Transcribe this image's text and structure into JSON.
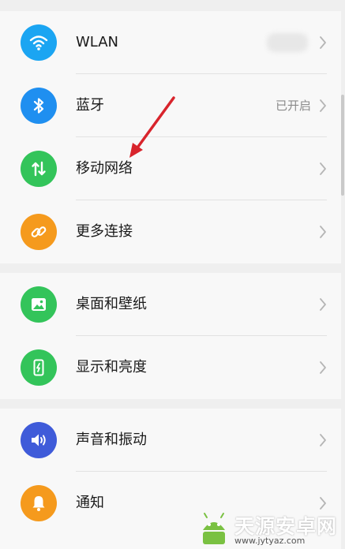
{
  "settings": {
    "wlan": {
      "label": "WLAN",
      "value": ""
    },
    "bluetooth": {
      "label": "蓝牙",
      "value": "已开启"
    },
    "mobile_network": {
      "label": "移动网络"
    },
    "more_connections": {
      "label": "更多连接"
    },
    "wallpaper": {
      "label": "桌面和壁纸"
    },
    "display": {
      "label": "显示和亮度"
    },
    "sound": {
      "label": "声音和振动"
    },
    "notifications": {
      "label": "通知"
    }
  },
  "icons": {
    "wlan": "wifi-icon",
    "bluetooth": "bluetooth-icon",
    "mobile_network": "data-arrows-icon",
    "more_connections": "link-icon",
    "wallpaper": "image-icon",
    "display": "phone-brightness-icon",
    "sound": "speaker-icon",
    "notifications": "bell-icon"
  },
  "colors": {
    "wlan": "#1ba5f2",
    "bluetooth": "#1f8ff0",
    "mobile_network": "#33c45a",
    "more_connections": "#f59a1d",
    "wallpaper": "#33c45a",
    "display": "#33c45a",
    "sound": "#3f5bd9",
    "notifications": "#f59a1d",
    "annotation_arrow": "#d8242c"
  },
  "watermark": {
    "title": "天源安卓网",
    "url": "www.jytyaz.com"
  }
}
